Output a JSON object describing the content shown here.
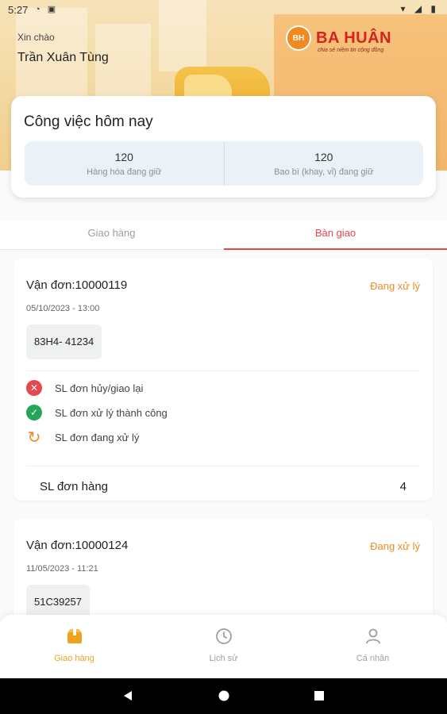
{
  "status_bar": {
    "time": "5:27",
    "left_icons": "◔ ▣",
    "right_icons": "▾ ◢ ▮"
  },
  "header": {
    "greeting": "Xin chào",
    "user_name": "Trần Xuân Tùng",
    "brand": {
      "mark": "BH",
      "name": "BA HUÂN",
      "tagline": "chia sẻ niềm tin cộng đồng"
    }
  },
  "today": {
    "title": "Công việc hôm nay",
    "stats": [
      {
        "value": "120",
        "label": "Hàng hóa đang giữ"
      },
      {
        "value": "120",
        "label": "Bao bì (khay, vỉ) đang giữ"
      }
    ]
  },
  "tabs": [
    {
      "label": "Giao hàng",
      "active": false
    },
    {
      "label": "Bàn giao",
      "active": true
    }
  ],
  "orders": [
    {
      "title": "Vận đơn:10000119",
      "status": "Đang xử lý",
      "date": "05/10/2023 - 13:00",
      "plate": "83H4- 41234",
      "legend": [
        {
          "icon": "cancel-icon",
          "label": "SL đơn hủy/giao lại"
        },
        {
          "icon": "check-icon",
          "label": "SL đơn xử lý thành công"
        },
        {
          "icon": "refresh-icon",
          "label": "SL đơn đang xử lý"
        }
      ],
      "count_label": "SL đơn hàng",
      "count_value": "4"
    },
    {
      "title": "Vận đơn:10000124",
      "status": "Đang xử lý",
      "date": "11/05/2023 - 11:21",
      "plate": "51C39257"
    }
  ],
  "bottom_nav": [
    {
      "label": "Giao hàng",
      "icon": "box-icon",
      "active": true
    },
    {
      "label": "Lịch sử",
      "icon": "clock-icon",
      "active": false
    },
    {
      "label": "Cá nhân",
      "icon": "person-icon",
      "active": false
    }
  ],
  "colors": {
    "accent": "#e5484d",
    "status_orange": "#f08a1e",
    "nav_active": "#f0a21e"
  }
}
